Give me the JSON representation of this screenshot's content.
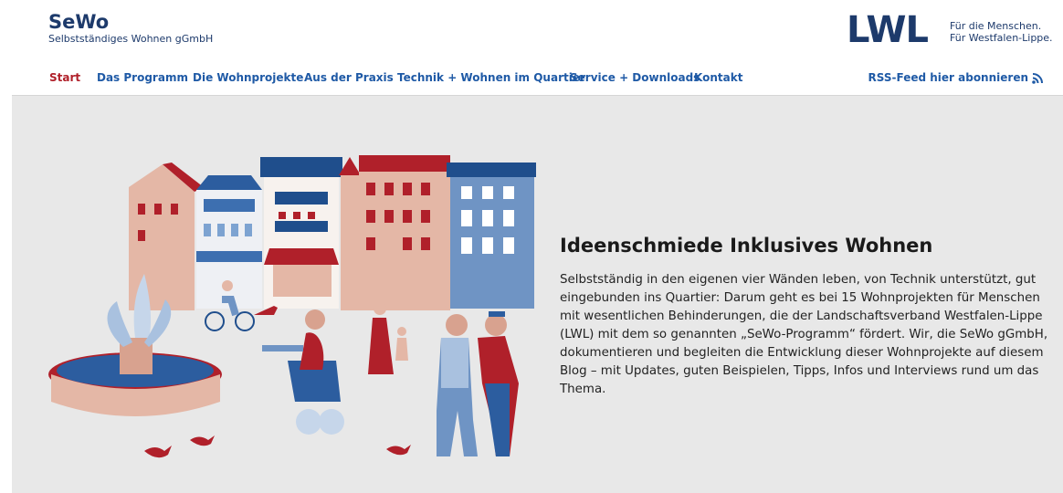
{
  "brand": {
    "title": "SeWo",
    "subtitle": "Selbstständiges Wohnen gGmbH"
  },
  "partner": {
    "logo": "LWL",
    "tagline_1": "Für die Menschen.",
    "tagline_2": "Für Westfalen-Lippe."
  },
  "nav": {
    "items": [
      {
        "label": "Start",
        "active": true
      },
      {
        "label": "Das Programm"
      },
      {
        "label": "Die Wohnprojekte"
      },
      {
        "label": "Aus der Praxis"
      },
      {
        "label": "Technik + Wohnen im Quartier"
      },
      {
        "label": "Service + Downloads"
      },
      {
        "label": "Kontakt"
      }
    ],
    "rss_label": "RSS-Feed hier abonnieren",
    "rss_icon": "rss-icon"
  },
  "hero": {
    "title": "Ideenschmiede Inklusives Wohnen",
    "text": "Selbstständig in den eigenen vier Wänden leben, von Technik unterstützt, gut eingebunden ins Quartier: Darum geht es bei 15 Wohnprojekten für Menschen mit wesentlichen Behinderungen, die der Landschaftsverband Westfalen-Lippe (LWL) mit dem so genannten „SeWo-Programm“ fördert. Wir, die SeWo gGmbH, dokumentieren und begleiten die Entwicklung dieser Wohnprojekte auf diesem Blog – mit Updates, guten Beispielen, Tipps, Infos und Interviews rund um das Thema."
  },
  "colors": {
    "navy": "#1d3a6b",
    "link": "#1f5aa6",
    "active": "#b0202a",
    "hero_bg": "#e8e8e8"
  }
}
